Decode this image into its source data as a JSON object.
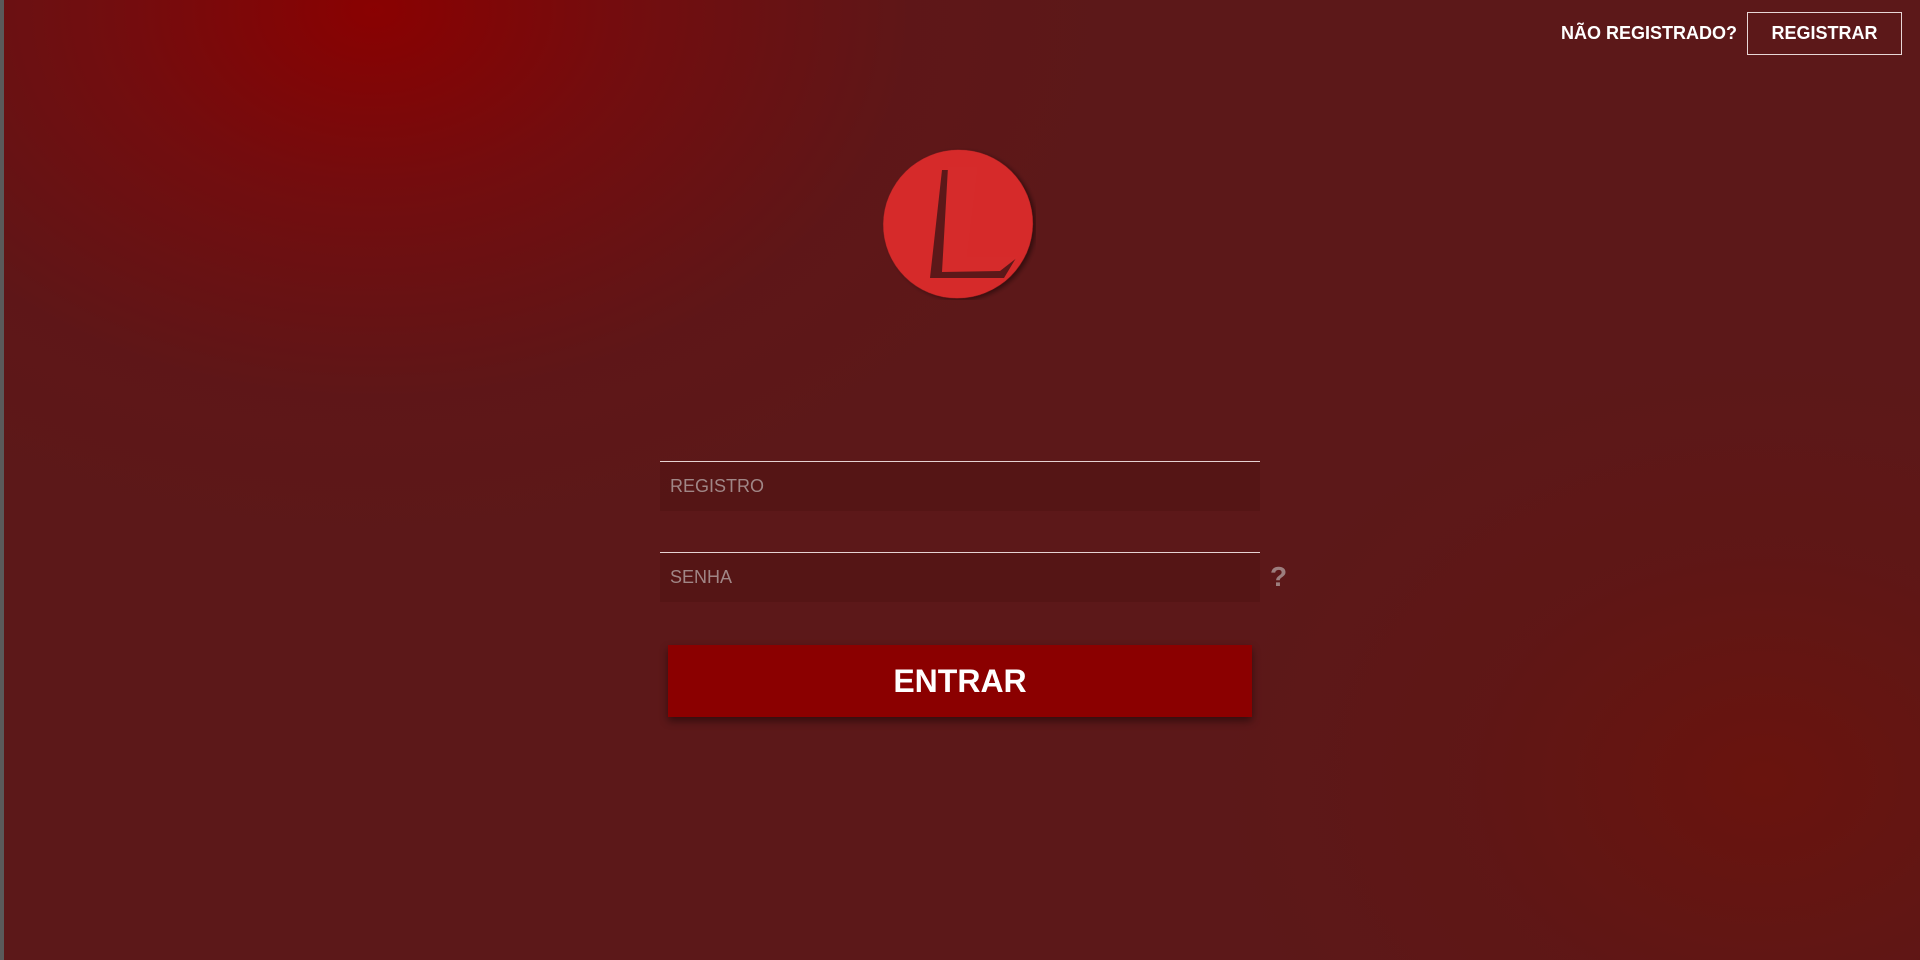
{
  "header": {
    "not_registered_label": "NÃO REGISTRADO?",
    "register_button_label": "REGISTRAR"
  },
  "logo": {
    "icon": "brand-logo-L",
    "brand_color": "#d62b2b"
  },
  "form": {
    "registro": {
      "value": "",
      "placeholder": "REGISTRO"
    },
    "senha": {
      "value": "",
      "placeholder": "SENHA"
    },
    "help_label": "?",
    "submit_label": "ENTRAR"
  },
  "colors": {
    "background": "#5c1819",
    "button": "#8b0000",
    "text": "#ffffff"
  }
}
